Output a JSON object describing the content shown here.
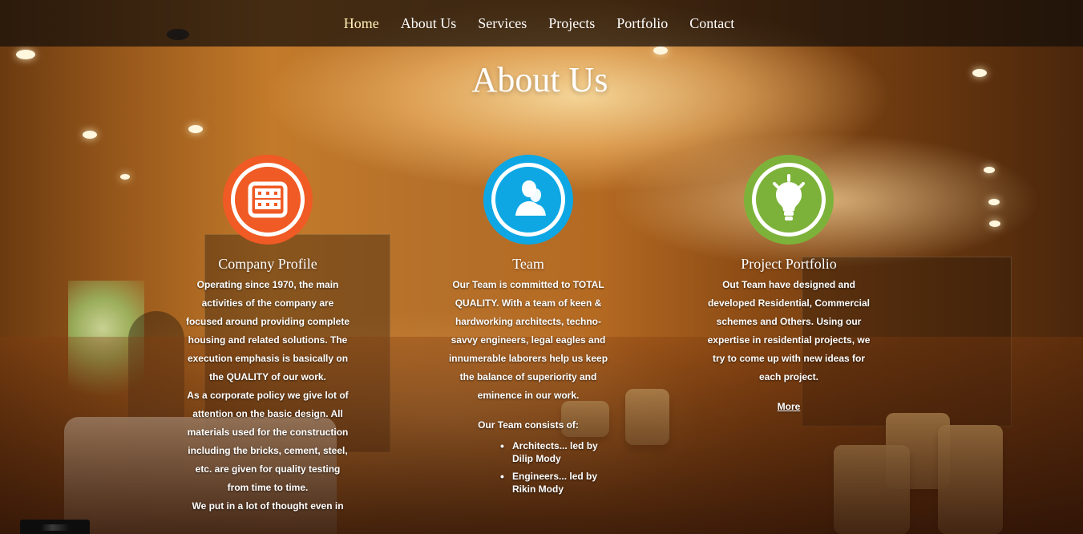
{
  "nav": {
    "items": [
      {
        "label": "Home",
        "active": true
      },
      {
        "label": "About Us",
        "active": false
      },
      {
        "label": "Services",
        "active": false
      },
      {
        "label": "Projects",
        "active": false
      },
      {
        "label": "Portfolio",
        "active": false
      },
      {
        "label": "Contact",
        "active": false
      }
    ]
  },
  "section": {
    "title": "About Us"
  },
  "colors": {
    "nav_active": "#fff2b5",
    "orange": "#f05a24",
    "blue": "#0ea7e4",
    "green": "#7db23a"
  },
  "columns": [
    {
      "icon": "grid-icon",
      "heading": "Company Profile",
      "paragraphs": [
        "Operating since 1970, the main activities of the company are focused around providing complete housing and related solutions. The execution emphasis is basically on the QUALITY of our work.",
        "As a corporate policy we give lot of attention on the basic design. All materials used for the construction including the bricks, cement, steel, etc. are given for quality testing from time to time.",
        "We put in a lot of thought even in"
      ]
    },
    {
      "icon": "team-icon",
      "heading": "Team",
      "paragraphs": [
        "Our Team is committed to TOTAL QUALITY. With a team of keen & hardworking architects, techno-savvy engineers, legal eagles and innumerable laborers help us keep the balance of superiority and eminence in our work.",
        "Our Team consists of:"
      ],
      "list": [
        "Architects... led by Dilip Mody",
        "Engineers... led by Rikin Mody"
      ]
    },
    {
      "icon": "lightbulb-icon",
      "heading": "Project Portfolio",
      "paragraphs": [
        "Out Team have designed and developed Residential, Commercial schemes and Others. Using our expertise in residential projects, we try to come up with new ideas for each project."
      ],
      "more": "More"
    }
  ]
}
